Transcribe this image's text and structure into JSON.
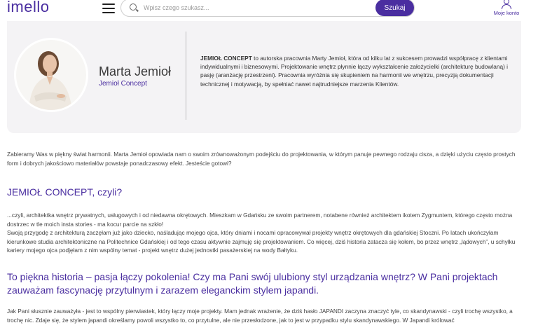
{
  "header": {
    "logo": "imello",
    "search_placeholder": "Wpisz czego szukasz...",
    "search_button": "Szukaj",
    "account_label": "Moje konto"
  },
  "profile": {
    "name": "Marta Jemioł",
    "company": "Jemioł Concept",
    "desc_bold": "JEMIOŁ CONCEPT",
    "desc_rest": " to autorska pracownia Marty Jemioł, która od kilku lat z sukcesem prowadzi współpracę z klientami indywidualnymi i biznesowymi. Projektowanie wnętrz płynnie łączy wykształcenie założycielki (architekturę budowlaną) i pasję (aranżację przestrzeni). Pracownia wyróżnia się skupieniem na harmonii we wnętrzu, precyzją dokumentacji technicznej i motywacją, by spełniać nawet najtrudniejsze marzenia Klientów."
  },
  "article": {
    "intro": "Zabieramy Was w piękny świat harmonii. Marta Jemioł opowiada nam o swoim zrównoważonym podejściu do projektowania, w którym panuje pewnego rodzaju cisza, a dzięki użyciu często prostych form i dobrych jakościowo materiałów powstaje ponadczasowy efekt. Jesteście gotowi?",
    "heading1": "JEMIOŁ CONCEPT, czyli?",
    "para1": "...czyli, architektka wnętrz prywatnych, usługowych i od niedawna okrętowych. Mieszkam w Gdańsku ze swoim partnerem, notabene również architektem ikotem Zygmuntem, którego często można dostrzec w tle moich insta stories - ma kocur parcie na szkło!",
    "para2": "Swoją przygodę z architekturą zaczęłam już jako dziecko, naśladując mojego ojca, który dniami i nocami opracowywał projekty wnętrz okrętowych dla gdańskiej Stoczni. Po latach ukończyłam kierunkowe studia architektoniczne na Politechnice Gdańskiej i od tego czasu aktywnie zajmuję się projektowaniem. Co więcej, dziś historia zatacza się kołem, bo przez wnętrz „lądowych”, u schyłku kariery mojego ojca podjęłam z nim wspólny temat - projekt wnętrz dużej jednostki pasażerskiej na wody Bałtyku.",
    "heading2": "To piękna historia – pasja łączy pokolenia! Czy ma Pani swój ulubiony styl urządzania wnętrz? W Pani projektach zauważam fascynację przytulnym i zarazem eleganckim stylem japandi.",
    "para3": "Jak Pani słusznie zauważyła - jest to wspólny pierwiastek, który łączy moje projekty. Mam jednak wrażenie, że dziś hasło JAPANDI zaczyna znaczyć tyle, co skandynawski - czyli trochę wszystko, a trochę nic. Zdaje się, że stylem japandi określamy powoli wszystko to, co przytulne, ale nie przesłodzone, jak to jest w przypadku stylu skandynawskiego. W Japandi królować"
  },
  "colors": {
    "accent": "#4a2ea0",
    "card_bg": "#f4f3f5"
  }
}
